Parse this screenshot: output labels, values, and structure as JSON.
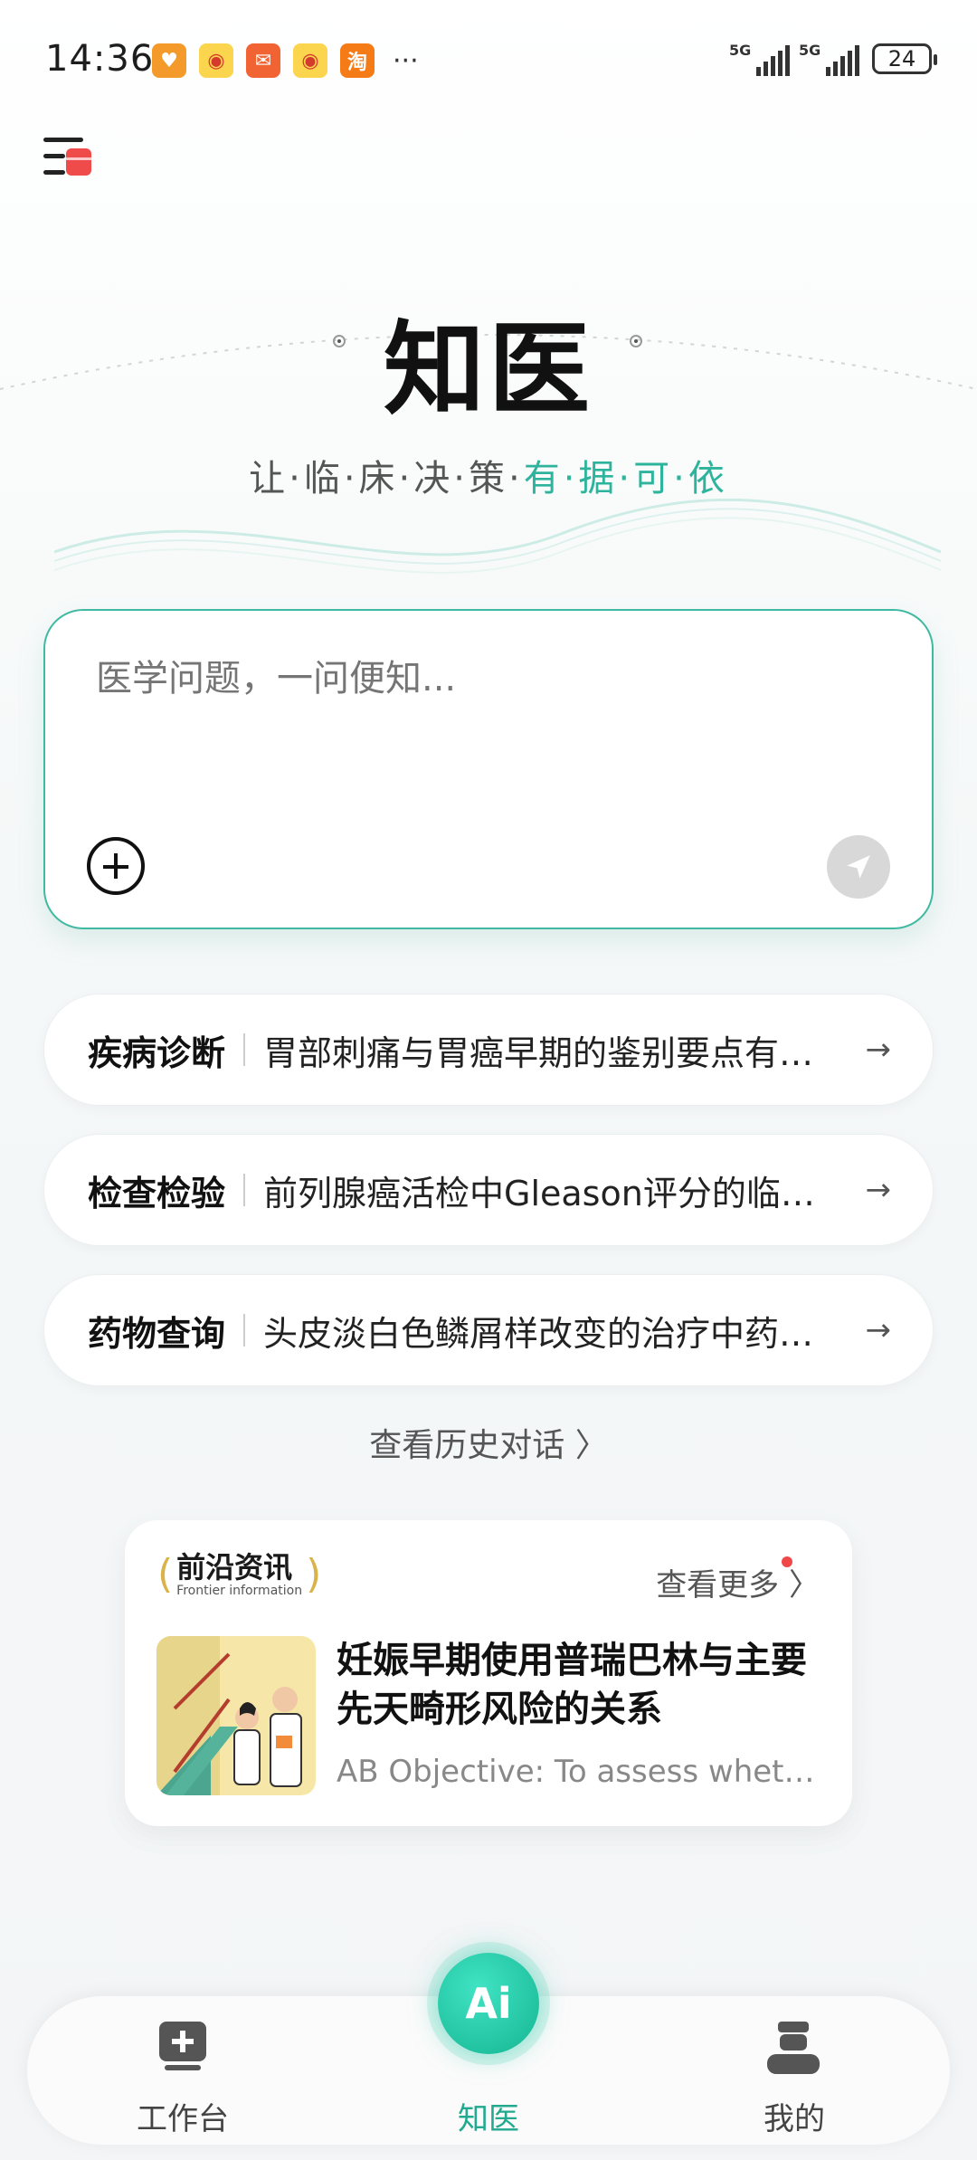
{
  "status_bar": {
    "time": "14:36",
    "notifications": [
      "heart-app-icon",
      "weibo-icon",
      "mail-app-icon",
      "weibo-icon",
      "taobao-icon"
    ],
    "taobao_label": "淘",
    "more": "···",
    "network_1": "5G",
    "network_2": "5G",
    "battery": "24"
  },
  "header": {
    "title": "知医",
    "slogan_part1": "让·临·床·决·策·",
    "slogan_part2": "有·据·可·依"
  },
  "question_box": {
    "placeholder": "医学问题，一问便知..."
  },
  "suggestions": [
    {
      "category": "疾病诊断",
      "question": "胃部刺痛与胃癌早期的鉴别要点有哪些",
      "arrow": "→"
    },
    {
      "category": "检查检验",
      "question": "前列腺癌活检中Gleason评分的临床意义",
      "arrow": "→"
    },
    {
      "category": "药物查询",
      "question": "头皮淡白色鳞屑样改变的治疗中药物选择",
      "arrow": "→"
    }
  ],
  "history_link": "查看历史对话 〉",
  "news": {
    "brand_cn": "前沿资讯",
    "brand_en": "Frontier information",
    "more": "查看更多 〉",
    "headline": "妊娠早期使用普瑞巴林与主要先天畸形风险的关系",
    "abstract": "AB Objective: To assess whether pregabalin exposure"
  },
  "bottom_nav": {
    "workbench": "工作台",
    "ai_button": "Ai",
    "zhiyi": "知医",
    "mine": "我的"
  },
  "colors": {
    "accent": "#2eb49c",
    "ai_gradient": "#14b592"
  }
}
